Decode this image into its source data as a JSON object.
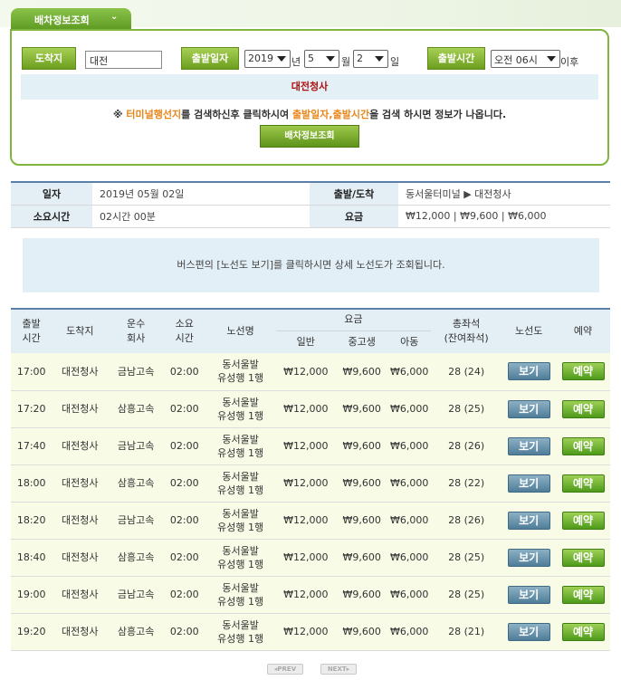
{
  "tab": {
    "title": "배차정보조회",
    "chevron": "⌄"
  },
  "search": {
    "arrival_label": "도착지",
    "arrival_value": "대전",
    "date_label": "출발일자",
    "year": "2019",
    "year_unit": "년",
    "month": "5",
    "month_unit": "월",
    "day": "2",
    "day_unit": "일",
    "time_label": "출발시간",
    "time_value": "오전 06시",
    "time_suffix": "이후",
    "result": "대전청사",
    "notice_prefix": "※ ",
    "notice_hl1": "터미널행선지",
    "notice_mid": "를 검색하신후 클릭하시여 ",
    "notice_hl2": "출발일자,출발시간",
    "notice_suffix": "을 검색 하시면 정보가 나옵니다.",
    "button": "배차정보조회"
  },
  "summary": {
    "date_h": "일자",
    "date_v": "2019년 05월 02일",
    "route_h": "출발/도착",
    "route_v": "동서울터미널 ▶ 대전청사",
    "duration_h": "소요시간",
    "duration_v": "02시간 00분",
    "fare_h": "요금",
    "fare_v": "₩12,000 | ₩9,600 | ₩6,000"
  },
  "info": "버스편의 [노선도 보기]를 클릭하시면 상세 노선도가 조회됩니다.",
  "table": {
    "headers": {
      "depart_time": [
        "출발",
        "시간"
      ],
      "destination": "도착지",
      "company": [
        "운수",
        "회사"
      ],
      "duration": [
        "소요",
        "시간"
      ],
      "route": "노선명",
      "fare": "요금",
      "fare_adult": "일반",
      "fare_student": "중고생",
      "fare_child": "아동",
      "seats": [
        "총좌석",
        "(잔여좌석)"
      ],
      "map": "노선도",
      "reserve": "예약"
    },
    "view_label": "보기",
    "reserve_label": "예약",
    "rows": [
      {
        "time": "17:00",
        "dest": "대전청사",
        "company": "금남고속",
        "dur": "02:00",
        "route1": "동서울발",
        "route2": "유성행 1행",
        "adult": "₩12,000",
        "student": "₩9,600",
        "child": "₩6,000",
        "seats": "28 (24)"
      },
      {
        "time": "17:20",
        "dest": "대전청사",
        "company": "삼흥고속",
        "dur": "02:00",
        "route1": "동서울발",
        "route2": "유성행 1행",
        "adult": "₩12,000",
        "student": "₩9,600",
        "child": "₩6,000",
        "seats": "28 (25)"
      },
      {
        "time": "17:40",
        "dest": "대전청사",
        "company": "금남고속",
        "dur": "02:00",
        "route1": "동서울발",
        "route2": "유성행 1행",
        "adult": "₩12,000",
        "student": "₩9,600",
        "child": "₩6,000",
        "seats": "28 (26)"
      },
      {
        "time": "18:00",
        "dest": "대전청사",
        "company": "삼흥고속",
        "dur": "02:00",
        "route1": "동서울발",
        "route2": "유성행 1행",
        "adult": "₩12,000",
        "student": "₩9,600",
        "child": "₩6,000",
        "seats": "28 (22)"
      },
      {
        "time": "18:20",
        "dest": "대전청사",
        "company": "금남고속",
        "dur": "02:00",
        "route1": "동서울발",
        "route2": "유성행 1행",
        "adult": "₩12,000",
        "student": "₩9,600",
        "child": "₩6,000",
        "seats": "28 (26)"
      },
      {
        "time": "18:40",
        "dest": "대전청사",
        "company": "삼흥고속",
        "dur": "02:00",
        "route1": "동서울발",
        "route2": "유성행 1행",
        "adult": "₩12,000",
        "student": "₩9,600",
        "child": "₩6,000",
        "seats": "28 (25)"
      },
      {
        "time": "19:00",
        "dest": "대전청사",
        "company": "금남고속",
        "dur": "02:00",
        "route1": "동서울발",
        "route2": "유성행 1행",
        "adult": "₩12,000",
        "student": "₩9,600",
        "child": "₩6,000",
        "seats": "28 (25)"
      },
      {
        "time": "19:20",
        "dest": "대전청사",
        "company": "삼흥고속",
        "dur": "02:00",
        "route1": "동서울발",
        "route2": "유성행 1행",
        "adult": "₩12,000",
        "student": "₩9,600",
        "child": "₩6,000",
        "seats": "28 (21)"
      }
    ]
  },
  "pager": {
    "prev": "◂PREV",
    "next": "NEXT▸"
  }
}
